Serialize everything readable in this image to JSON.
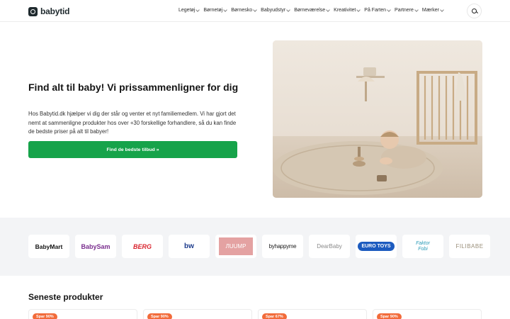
{
  "header": {
    "logo_text": "babytid",
    "nav": [
      "Legetøj",
      "Børnetøj",
      "Børnesko",
      "Babyudstyr",
      "Børneværelse",
      "Kreativitet",
      "På Farten",
      "Partnere",
      "Mærker"
    ]
  },
  "hero": {
    "title": "Find alt til baby! Vi prissammenligner for dig",
    "text": "Hos Babytid.dk hjælper vi dig der står og venter et nyt familiemedlem. Vi har gjort det nemt at sammenligne produkter hos over +30 forskellige forhandlere, så du kan finde de bedste priser på alt til babyer!",
    "cta_label": "Find de bedste tilbud »"
  },
  "brands": [
    "BabyMart",
    "BabySam",
    "BERG",
    "bw",
    "ЛUUMP",
    "byhappyme",
    "DearBaby",
    "EURO TOYS",
    "Faktor Fobi",
    "FILIBABE"
  ],
  "latest": {
    "title": "Seneste produkter",
    "badges": [
      "Spar 90%",
      "Spar 90%",
      "Spar 67%",
      "Spar 90%"
    ]
  },
  "colors": {
    "accent": "#16a34a",
    "badge": "#f26b3a",
    "band": "#f3f4f6"
  }
}
